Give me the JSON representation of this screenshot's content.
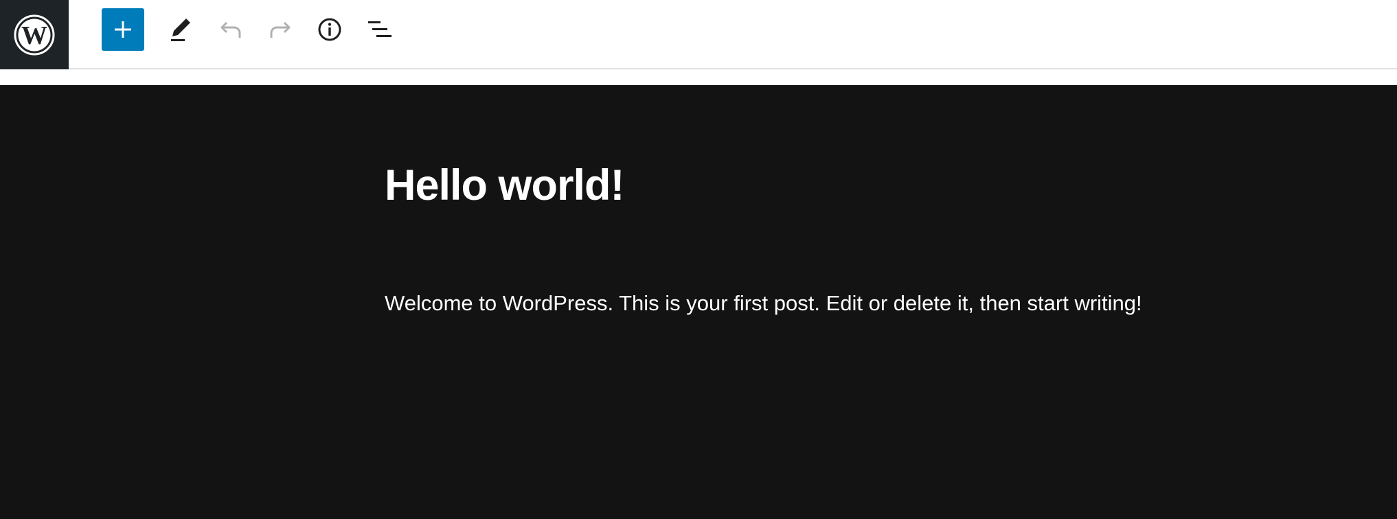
{
  "toolbar": {
    "logo_icon": "wordpress-logo-icon",
    "tools": [
      {
        "name": "add-block-button",
        "icon": "plus-icon"
      },
      {
        "name": "tools-button",
        "icon": "pencil-icon"
      },
      {
        "name": "undo-button",
        "icon": "undo-icon"
      },
      {
        "name": "redo-button",
        "icon": "redo-icon"
      },
      {
        "name": "details-button",
        "icon": "info-icon"
      },
      {
        "name": "document-overview-button",
        "icon": "list-view-icon"
      }
    ],
    "colors": {
      "logo_bg": "#1e2327",
      "accent": "#007cba",
      "disabled_icon": "#b0b0b0",
      "icon": "#1e1e1e"
    }
  },
  "post": {
    "title": "Hello world!",
    "paragraph": "Welcome to WordPress. This is your first post. Edit or delete it, then start writing!"
  },
  "canvas": {
    "background": "#131313",
    "text_color": "#ffffff"
  }
}
